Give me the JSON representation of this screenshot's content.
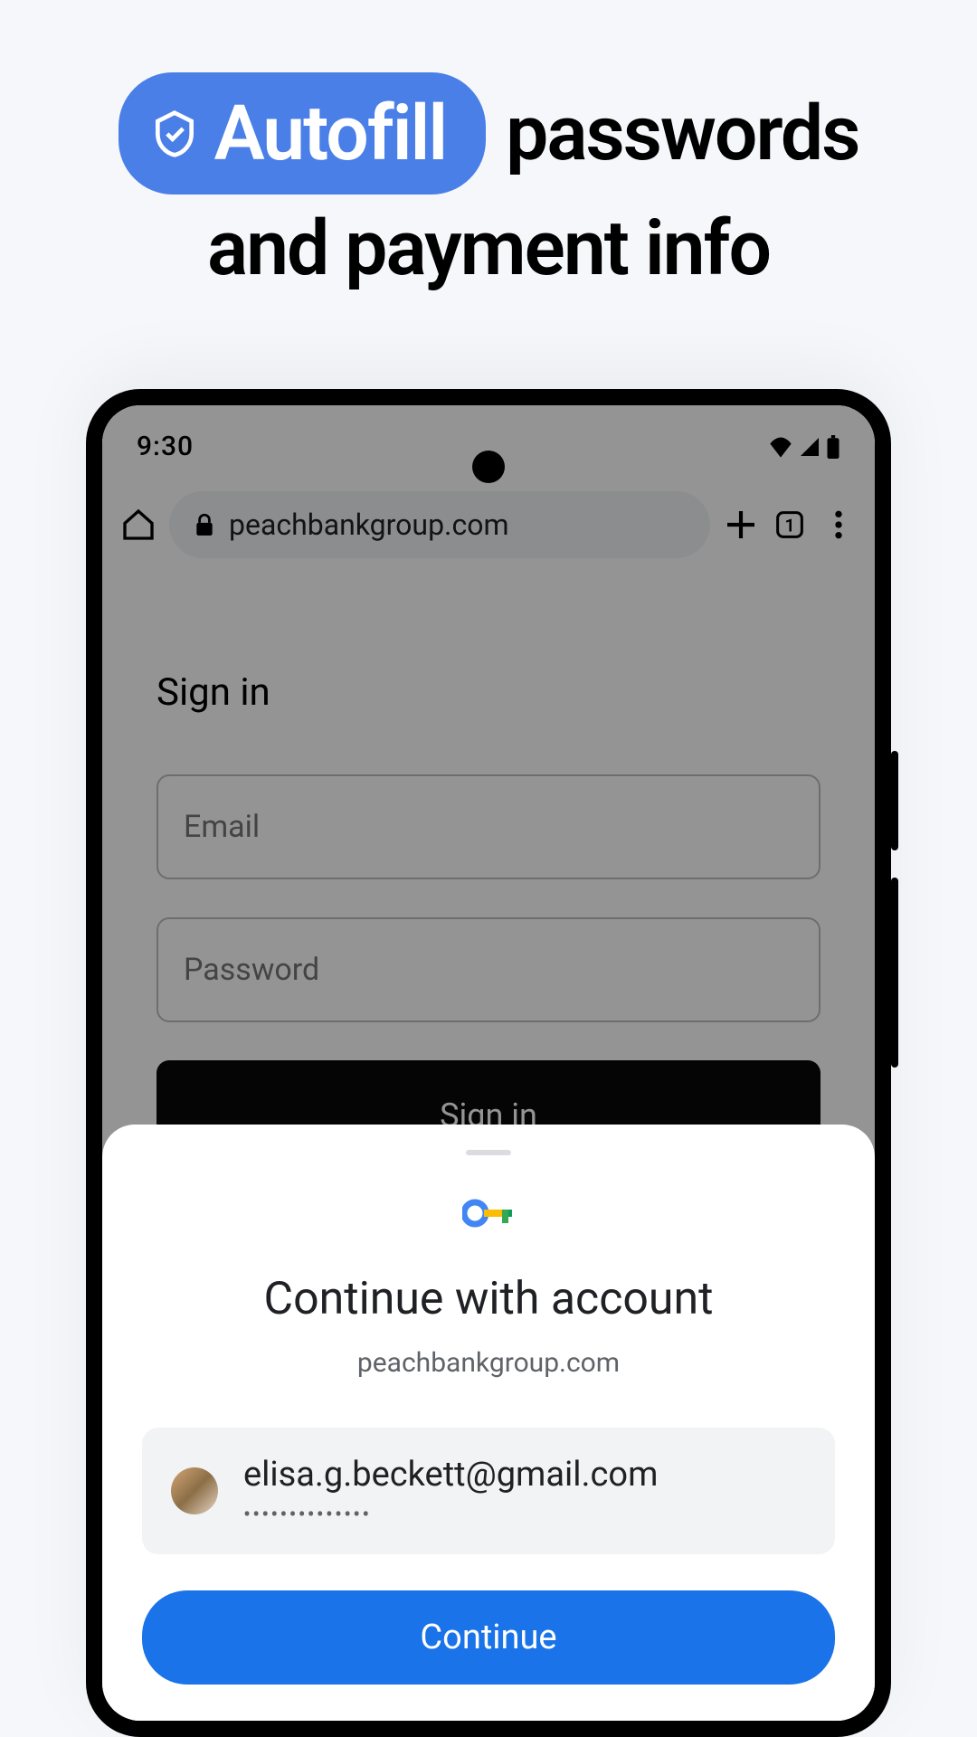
{
  "headline": {
    "pill_text": "Autofill",
    "line1_rest": "passwords",
    "line2": "and payment info"
  },
  "status": {
    "time": "9:30"
  },
  "browser": {
    "url": "peachbankgroup.com",
    "tab_count": "1"
  },
  "page": {
    "heading": "Sign in",
    "email_placeholder": "Email",
    "password_placeholder": "Password",
    "submit_label": "Sign in"
  },
  "sheet": {
    "title": "Continue with account",
    "subtitle": "peachbankgroup.com",
    "account_email": "elisa.g.beckett@gmail.com",
    "account_password_mask": "••••••••••••••",
    "continue_label": "Continue"
  }
}
